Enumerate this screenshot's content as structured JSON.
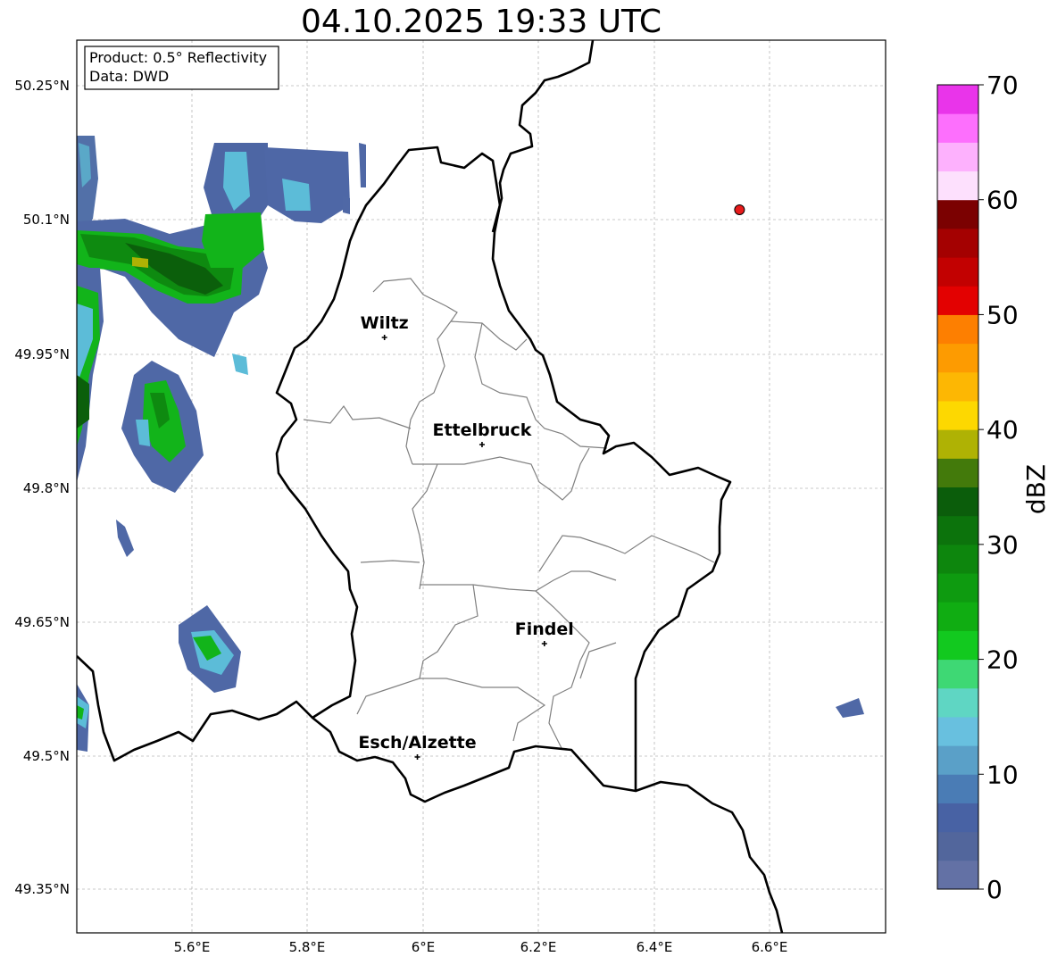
{
  "title": "04.10.2025 19:33 UTC",
  "info_box": {
    "product": "Product: 0.5° Reflectivity",
    "data_source": "Data: DWD"
  },
  "lat_ticks": [
    "50.25°N",
    "50.1°N",
    "49.95°N",
    "49.8°N",
    "49.65°N",
    "49.5°N",
    "49.35°N"
  ],
  "lon_ticks": [
    "5.6°E",
    "5.8°E",
    "6°E",
    "6.2°E",
    "6.4°E",
    "6.6°E"
  ],
  "cities": [
    {
      "name": "Wiltz",
      "lon": 5.933,
      "lat": 49.968
    },
    {
      "name": "Ettelbruck",
      "lon": 6.102,
      "lat": 49.848
    },
    {
      "name": "Findel",
      "lon": 6.21,
      "lat": 49.625
    },
    {
      "name": "Esch/Alzette",
      "lon": 5.99,
      "lat": 49.498
    }
  ],
  "radar_site": {
    "lon": 6.548,
    "lat": 50.111
  },
  "colorbar": {
    "label": "dBZ",
    "ticks": [
      "0",
      "10",
      "20",
      "30",
      "40",
      "50",
      "60",
      "70"
    ],
    "colors": [
      "#6371a5",
      "#52669c",
      "#4862a4",
      "#4a7cb5",
      "#5aa0c8",
      "#68c0df",
      "#5fd6c3",
      "#3ed874",
      "#12c91f",
      "#10ad12",
      "#0e9b10",
      "#0d860d",
      "#0c730c",
      "#0b5d0b",
      "#437a0b",
      "#afb204",
      "#fdd801",
      "#fdb703",
      "#fd9b01",
      "#fd7f01",
      "#e30101",
      "#c20101",
      "#a40101",
      "#7b0101",
      "#fde0fd",
      "#fdb1fd",
      "#fd6ffd",
      "#e934ea"
    ]
  }
}
